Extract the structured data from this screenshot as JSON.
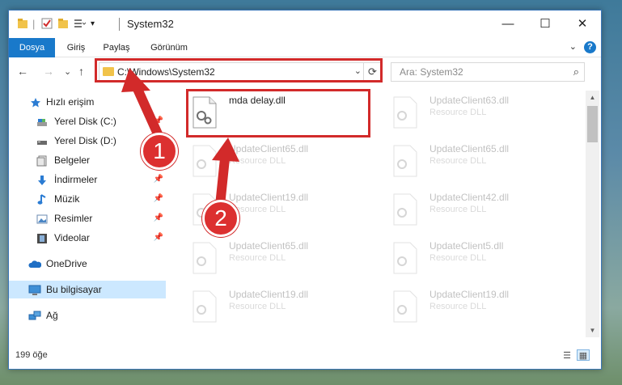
{
  "window": {
    "title": "System32",
    "minimize": "—",
    "maximize": "☐",
    "close": "✕"
  },
  "ribbon": {
    "tabs": [
      {
        "label": "Dosya"
      },
      {
        "label": "Giriş"
      },
      {
        "label": "Paylaş"
      },
      {
        "label": "Görünüm"
      }
    ],
    "help": "?",
    "collapse": "⌄"
  },
  "nav": {
    "back": "←",
    "forward": "→",
    "recent": "⌄",
    "up": "↑",
    "address": "C:\\Windows\\System32",
    "address_dropdown": "⌄",
    "refresh": "⟳",
    "search_placeholder": "Ara: System32",
    "search_icon": "⌕"
  },
  "sidebar": {
    "items": [
      {
        "label": "Hızlı erişim",
        "icon": "star-icon",
        "pin": ""
      },
      {
        "label": "Yerel Disk (C:)",
        "icon": "drive-icon",
        "pin": "📌"
      },
      {
        "label": "Yerel Disk (D:)",
        "icon": "drive-icon",
        "pin": ""
      },
      {
        "label": "Belgeler",
        "icon": "documents-icon",
        "pin": "📌"
      },
      {
        "label": "İndirmeler",
        "icon": "download-icon",
        "pin": "📌"
      },
      {
        "label": "Müzik",
        "icon": "music-icon",
        "pin": "📌"
      },
      {
        "label": "Resimler",
        "icon": "pictures-icon",
        "pin": "📌"
      },
      {
        "label": "Videolar",
        "icon": "videos-icon",
        "pin": "📌"
      },
      {
        "label": "OneDrive",
        "icon": "cloud-icon",
        "pin": ""
      },
      {
        "label": "Bu bilgisayar",
        "icon": "computer-icon",
        "pin": ""
      },
      {
        "label": "Ağ",
        "icon": "network-icon",
        "pin": ""
      }
    ]
  },
  "files": {
    "highlighted": {
      "name": "mda delay.dll",
      "type": ""
    },
    "items": [
      {
        "name": "UpdateClient63.dll",
        "type": "Resource DLL"
      },
      {
        "name": "UpdateClient65.dll",
        "type": "Resource DLL"
      },
      {
        "name": "UpdateClient65.dll",
        "type": "Resource DLL"
      },
      {
        "name": "UpdateClient19.dll",
        "type": "Resource DLL"
      },
      {
        "name": "UpdateClient42.dll",
        "type": "Resource DLL"
      },
      {
        "name": "UpdateClient65.dll",
        "type": "Resource DLL"
      },
      {
        "name": "UpdateClient5.dll",
        "type": "Resource DLL"
      },
      {
        "name": "UpdateClient19.dll",
        "type": "Resource DLL"
      },
      {
        "name": "UpdateClient19.dll",
        "type": "Resource DLL"
      }
    ]
  },
  "status": {
    "count": "199 öğe"
  },
  "annotations": {
    "step1": "1",
    "step2": "2",
    "color": "#d22a2a"
  }
}
